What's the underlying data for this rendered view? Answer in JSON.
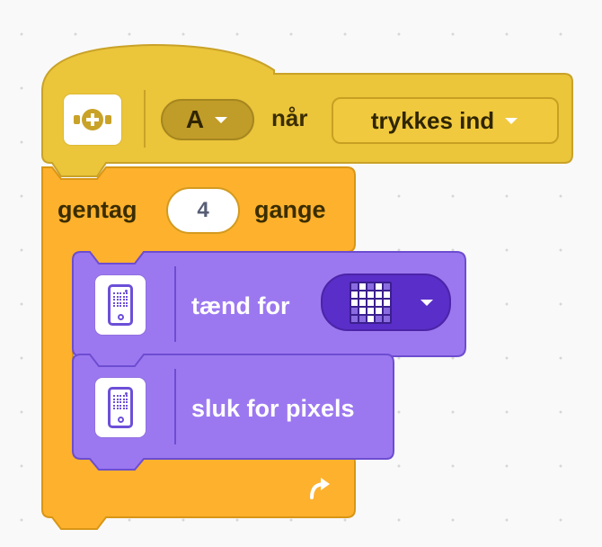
{
  "colors": {
    "event": "#ebc53a",
    "event_border": "#c9a228",
    "control": "#fdb12d",
    "control_border": "#d99615",
    "display": "#9c78f0",
    "display_border": "#6d4dd1"
  },
  "icons": {
    "event_block": "button-press-icon",
    "display_blocks": "hub-display-icon",
    "loop_end": "curved-arrow-icon"
  },
  "event_block": {
    "port_value": "A",
    "when_label": "når",
    "event_value": "trykkes ind"
  },
  "repeat_block": {
    "label_prefix": "gentag",
    "count": "4",
    "label_suffix": "gange"
  },
  "light_block": {
    "label": "tænd for",
    "pattern": [
      [
        0,
        1,
        0,
        1,
        0
      ],
      [
        1,
        1,
        1,
        1,
        1
      ],
      [
        1,
        1,
        1,
        1,
        1
      ],
      [
        0,
        1,
        1,
        1,
        0
      ],
      [
        0,
        0,
        1,
        0,
        0
      ]
    ]
  },
  "off_block": {
    "label": "sluk for pixels"
  }
}
